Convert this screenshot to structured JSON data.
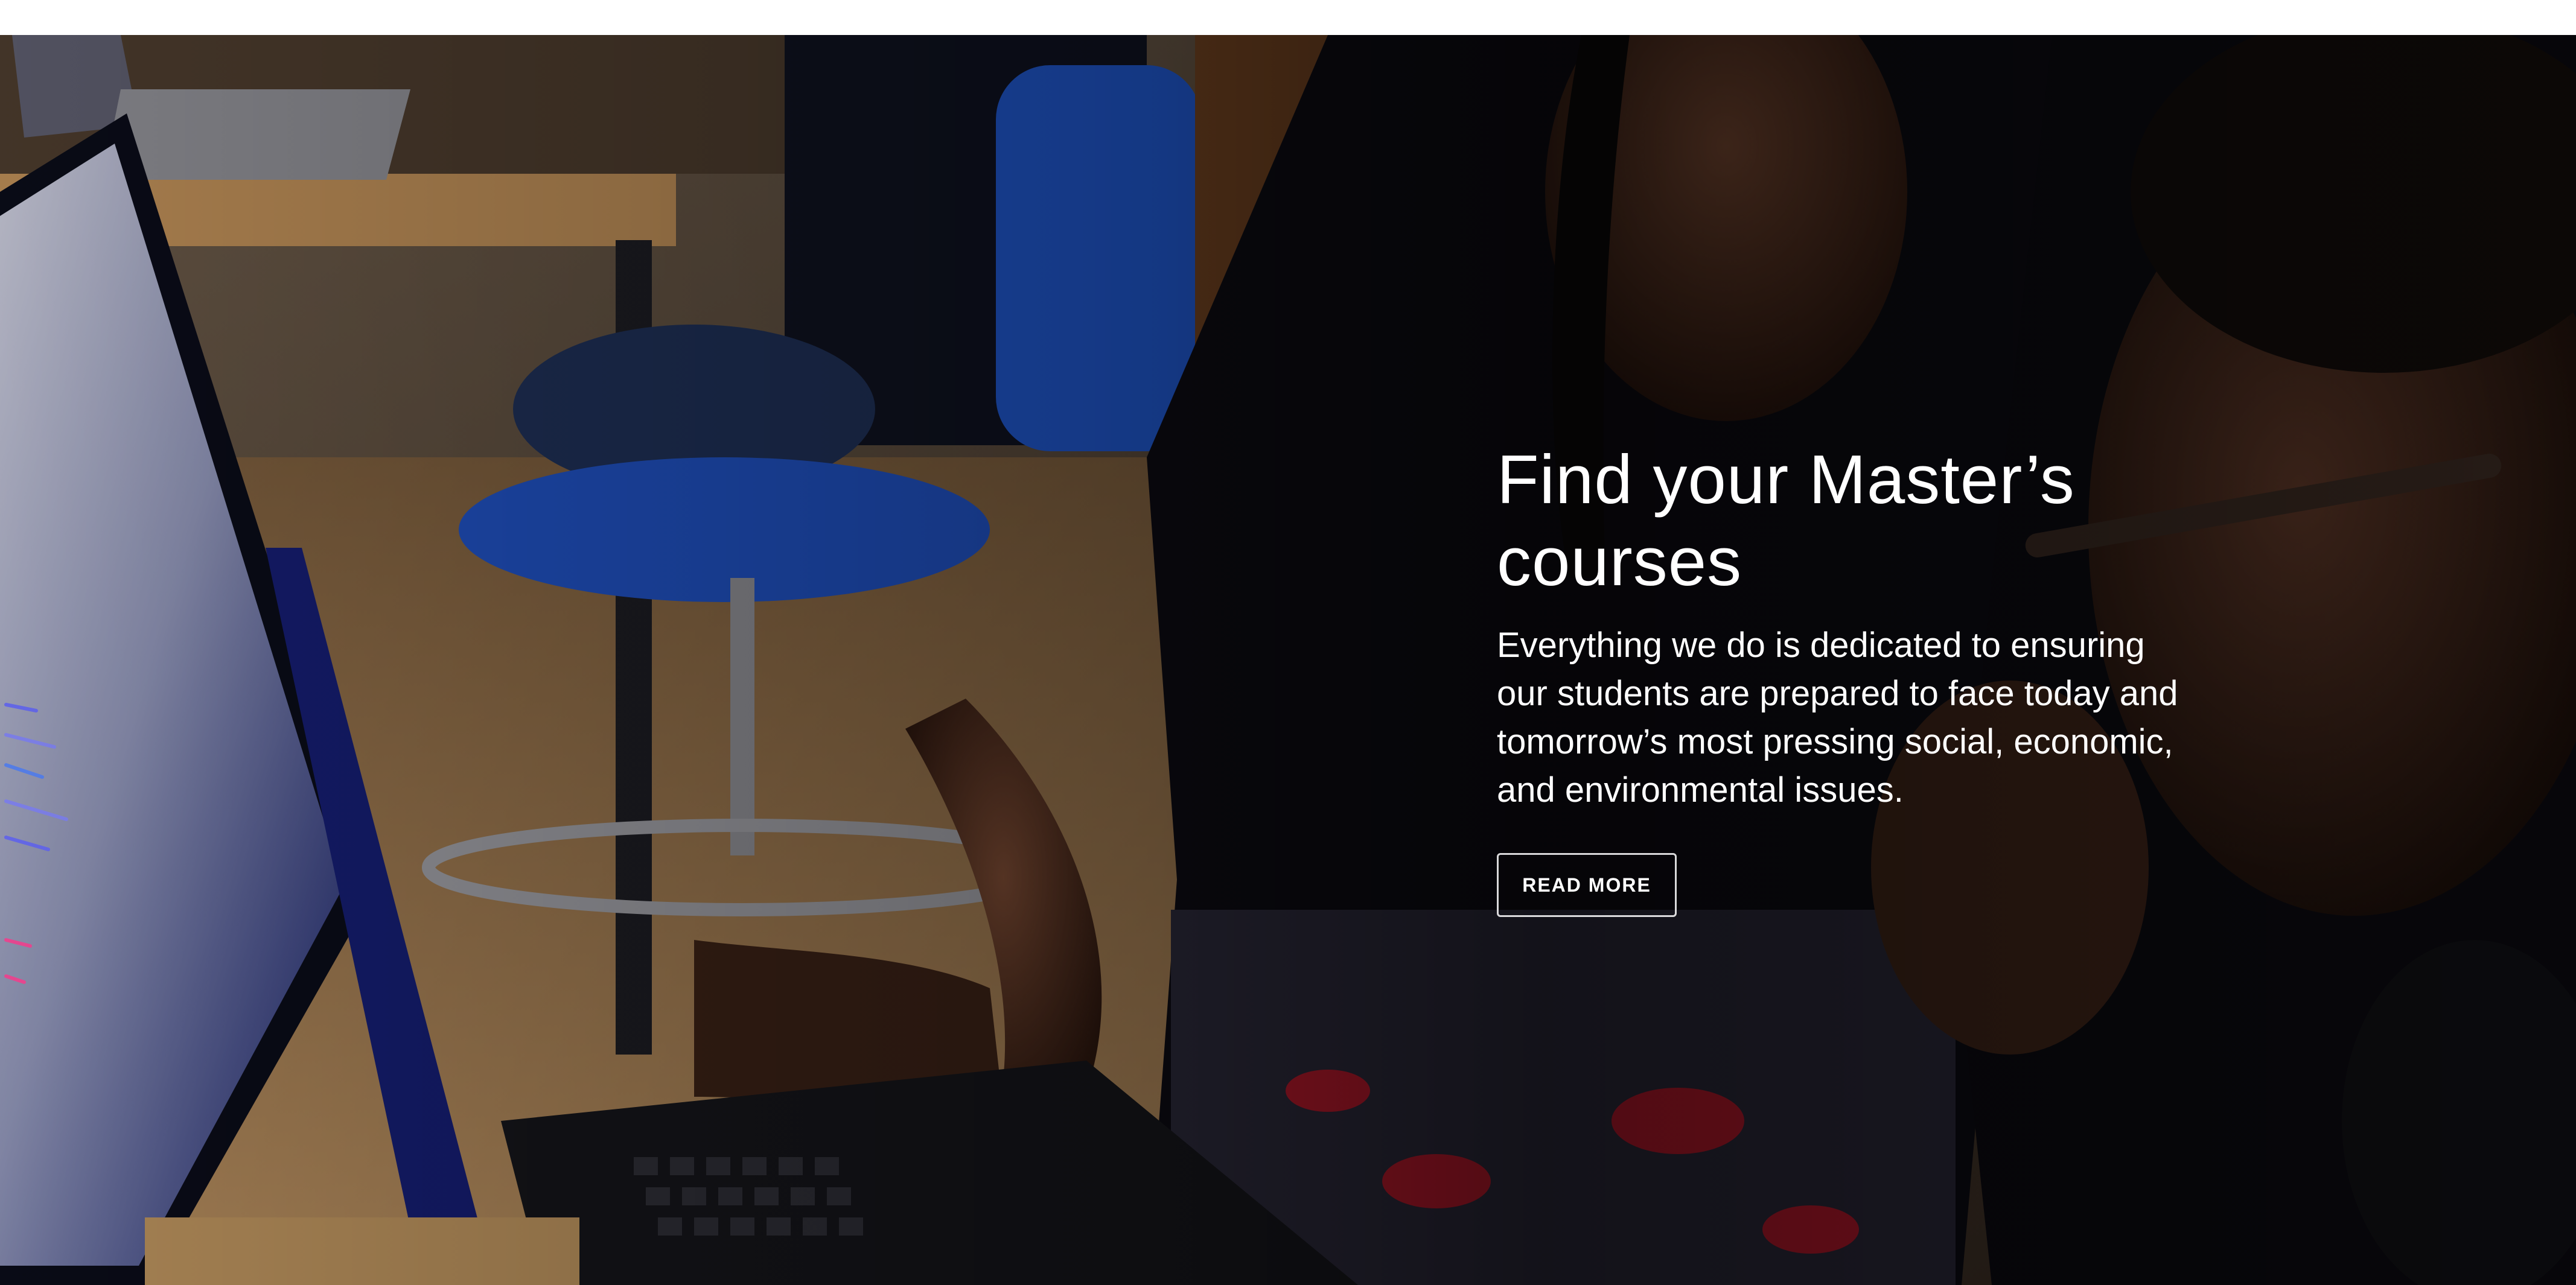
{
  "hero": {
    "title": "Find your Master’s courses",
    "description": "Everything we do is dedicated to ensuring our students are prepared to face today and tomorrow’s most pressing social, economic, and environmental issues.",
    "button_label": "READ MORE",
    "image_icon": "photo-students-at-laptop"
  },
  "colors": {
    "text": "#ffffff",
    "chair_blue": "#1f55c8",
    "desk_wood": "#c89a5a"
  }
}
